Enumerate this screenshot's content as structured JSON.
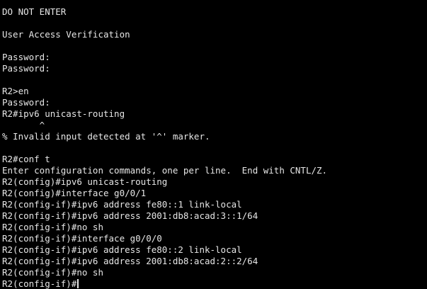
{
  "terminal": {
    "lines": [
      "DO NOT ENTER",
      "",
      "User Access Verification",
      "",
      "Password:",
      "Password:",
      "",
      "R2>en",
      "Password:",
      "R2#ipv6 unicast-routing",
      "       ^",
      "% Invalid input detected at '^' marker.",
      "",
      "R2#conf t",
      "Enter configuration commands, one per line.  End with CNTL/Z.",
      "R2(config)#ipv6 unicast-routing",
      "R2(config)#interface g0/0/1",
      "R2(config-if)#ipv6 address fe80::1 link-local",
      "R2(config-if)#ipv6 address 2001:db8:acad:3::1/64",
      "R2(config-if)#no sh",
      "R2(config-if)#interface g0/0/0",
      "R2(config-if)#ipv6 address fe80::2 link-local",
      "R2(config-if)#ipv6 address 2001:db8:acad:2::2/64",
      "R2(config-if)#no sh"
    ],
    "prompt": "R2(config-if)#",
    "colors": {
      "background": "#000000",
      "foreground": "#e6e6e6"
    }
  }
}
